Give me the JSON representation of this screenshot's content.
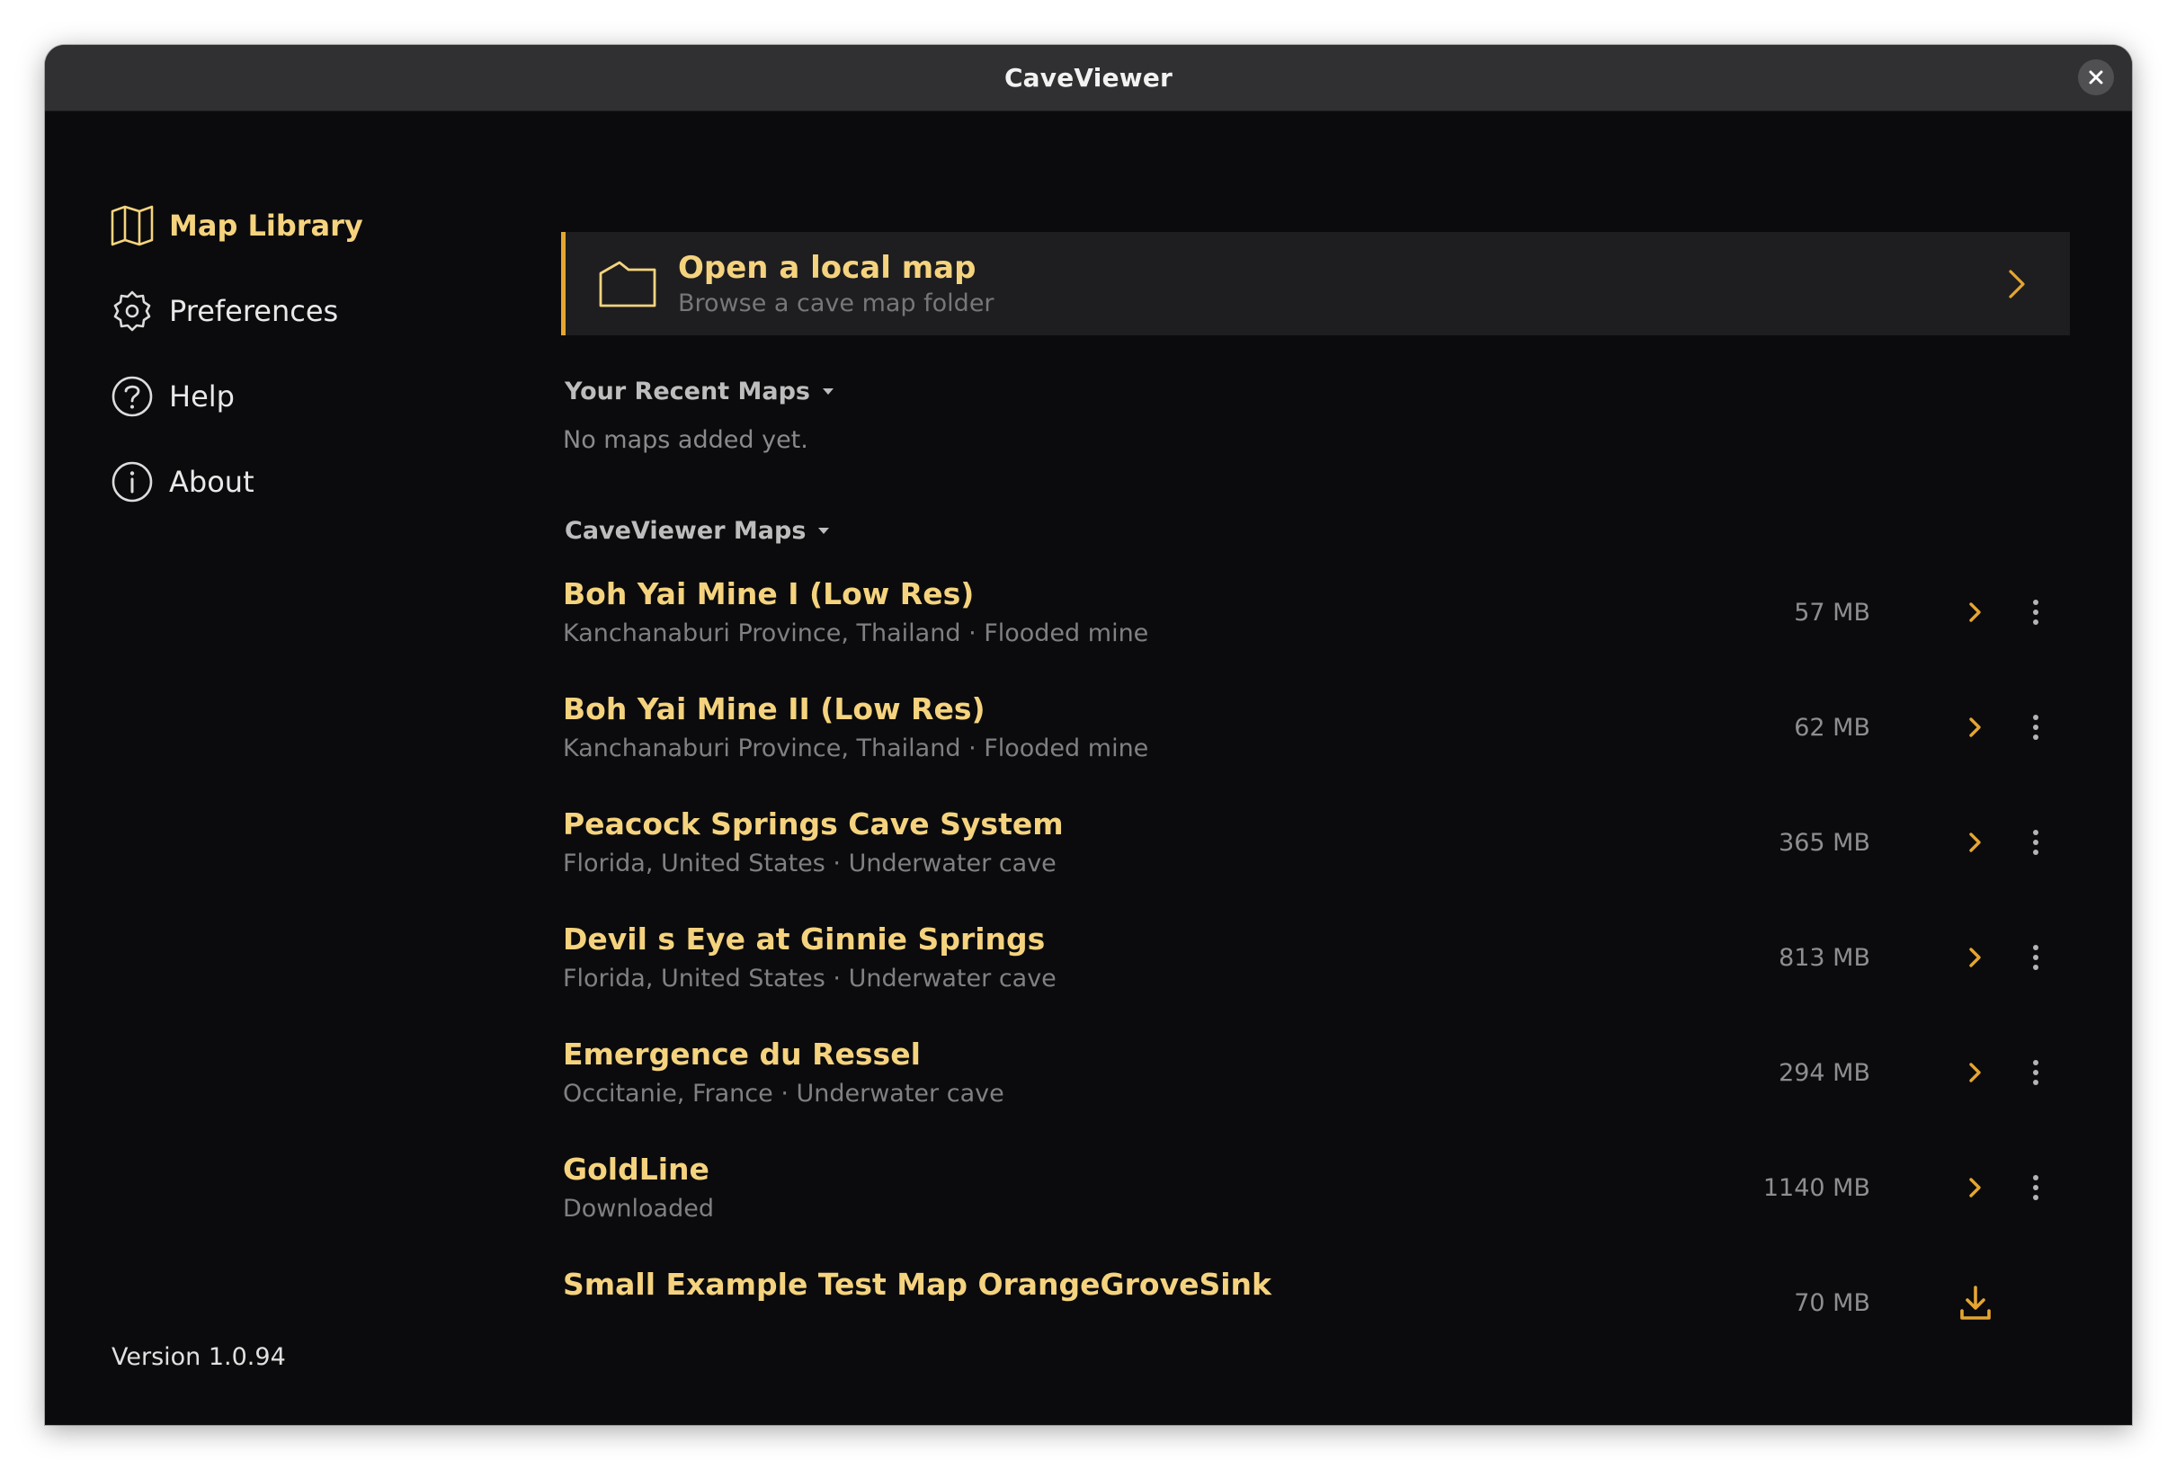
{
  "window": {
    "title": "CaveViewer"
  },
  "sidebar": {
    "items": [
      {
        "label": "Map Library",
        "icon": "map-icon",
        "active": true
      },
      {
        "label": "Preferences",
        "icon": "gear-icon",
        "active": false
      },
      {
        "label": "Help",
        "icon": "help-icon",
        "active": false
      },
      {
        "label": "About",
        "icon": "info-icon",
        "active": false
      }
    ],
    "version": "Version 1.0.94"
  },
  "main": {
    "open_local": {
      "title": "Open a local map",
      "subtitle": "Browse a cave map folder",
      "icon": "folder-icon"
    },
    "recent": {
      "header": "Your Recent Maps",
      "empty": "No maps added yet."
    },
    "maps_section": {
      "header": "CaveViewer Maps"
    },
    "maps": [
      {
        "name": "Boh Yai Mine I (Low Res)",
        "subtitle": "Kanchanaburi Province, Thailand · Flooded mine",
        "size": "57 MB",
        "action": "open"
      },
      {
        "name": "Boh Yai Mine II (Low Res)",
        "subtitle": "Kanchanaburi Province, Thailand · Flooded mine",
        "size": "62 MB",
        "action": "open"
      },
      {
        "name": "Peacock Springs Cave System",
        "subtitle": "Florida, United States · Underwater cave",
        "size": "365 MB",
        "action": "open"
      },
      {
        "name": "Devil s Eye at Ginnie Springs",
        "subtitle": "Florida, United States · Underwater cave",
        "size": "813 MB",
        "action": "open"
      },
      {
        "name": "Emergence du Ressel",
        "subtitle": "Occitanie, France · Underwater cave",
        "size": "294 MB",
        "action": "open"
      },
      {
        "name": "GoldLine",
        "subtitle": "Downloaded",
        "size": "1140 MB",
        "action": "open"
      },
      {
        "name": "Small Example Test Map OrangeGroveSink",
        "subtitle": "",
        "size": "70 MB",
        "action": "download"
      }
    ]
  },
  "colors": {
    "accent": "#e5a631",
    "accent_text": "#f5d37e",
    "background": "#0b0b0d",
    "titlebar": "#303032"
  }
}
